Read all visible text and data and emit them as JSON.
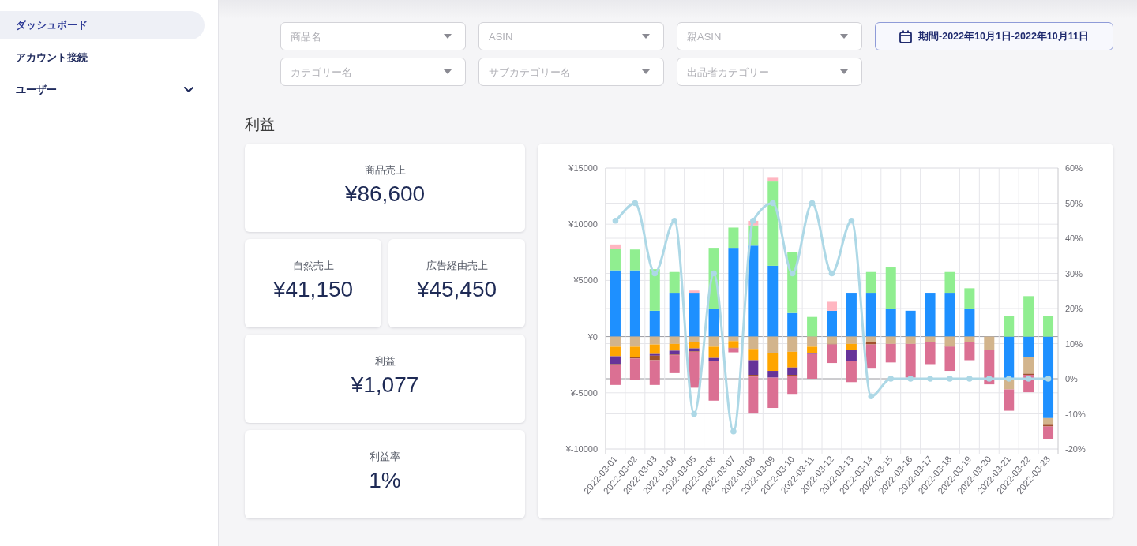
{
  "sidebar": {
    "items": [
      {
        "kind": "link",
        "label": "ダッシュボード",
        "selected": true
      },
      {
        "kind": "link",
        "label": "アカウント接続",
        "selected": false
      },
      {
        "kind": "group",
        "label": "ユーザー",
        "selected": false,
        "expanded": false
      }
    ]
  },
  "filters": [
    {
      "placeholder": "商品名"
    },
    {
      "placeholder": "ASIN"
    },
    {
      "placeholder": "親ASIN"
    },
    {
      "placeholder": "カテゴリー名"
    },
    {
      "placeholder": "サブカテゴリー名"
    },
    {
      "placeholder": "出品者カテゴリー"
    }
  ],
  "date_button": {
    "label": "期間-2022年10月1日-2022年10月11日"
  },
  "section": {
    "title": "利益"
  },
  "metric_rows": [
    [
      {
        "label": "商品売上",
        "value": "¥86,600"
      }
    ],
    [
      {
        "label": "自然売上",
        "value": "¥41,150"
      },
      {
        "label": "広告経由売上",
        "value": "¥45,450"
      }
    ],
    [
      {
        "label": "利益",
        "value": "¥1,077"
      }
    ],
    [
      {
        "label": "利益率",
        "value": "1%"
      }
    ]
  ],
  "chart": {
    "chart_data": {
      "type": "bar",
      "stacked": true,
      "grid": true,
      "categories": [
        "2022-03-01",
        "2022-03-02",
        "2022-03-03",
        "2022-03-04",
        "2022-03-05",
        "2022-03-06",
        "2022-03-07",
        "2022-03-08",
        "2022-03-09",
        "2022-03-10",
        "2022-03-11",
        "2022-03-12",
        "2022-03-13",
        "2022-03-14",
        "2022-03-15",
        "2022-03-16",
        "2022-03-17",
        "2022-03-18",
        "2022-03-19",
        "2022-03-20",
        "2022-03-21",
        "2022-03-22",
        "2022-03-23"
      ],
      "ylim": [
        -10000,
        15000
      ],
      "yticks": [
        {
          "value": 15000,
          "label": "¥15000"
        },
        {
          "value": 10000,
          "label": "¥10000"
        },
        {
          "value": 5000,
          "label": "¥5000"
        },
        {
          "value": 0,
          "label": "¥0"
        },
        {
          "value": -5000,
          "label": "¥-5000"
        },
        {
          "value": -10000,
          "label": "¥-10000"
        }
      ],
      "y2lim": [
        -20,
        60
      ],
      "y2ticks": [
        {
          "value": 60,
          "label": "60%"
        },
        {
          "value": 50,
          "label": "50%"
        },
        {
          "value": 40,
          "label": "40%"
        },
        {
          "value": 30,
          "label": "30%"
        },
        {
          "value": 20,
          "label": "20%"
        },
        {
          "value": 10,
          "label": "10%"
        },
        {
          "value": 0,
          "label": "0%"
        },
        {
          "value": -10,
          "label": "-10%"
        },
        {
          "value": -20,
          "label": "-20%"
        }
      ],
      "series": [
        {
          "type": "bar",
          "color": "#1e90ff",
          "values": [
            5900,
            5900,
            2300,
            3900,
            3900,
            2500,
            7900,
            8100,
            6300,
            2100,
            0,
            2300,
            3900,
            3900,
            2500,
            2300,
            3900,
            3900,
            2500,
            0,
            -3750,
            -1850,
            -7250
          ]
        },
        {
          "type": "bar",
          "color": "#90ee90",
          "values": [
            1900,
            1850,
            3700,
            1850,
            0,
            5400,
            1800,
            1800,
            7500,
            5450,
            1750,
            0,
            0,
            1850,
            3650,
            0,
            0,
            1850,
            1800,
            0,
            1800,
            3600,
            1800
          ]
        },
        {
          "type": "bar",
          "color": "#ffb6c1",
          "values": [
            400,
            0,
            0,
            0,
            200,
            0,
            0,
            400,
            400,
            0,
            0,
            800,
            0,
            0,
            0,
            0,
            0,
            0,
            0,
            0,
            0,
            0,
            0
          ]
        },
        {
          "type": "bar",
          "color": "#d2b48c",
          "values": [
            -900,
            -900,
            -700,
            -650,
            -450,
            -900,
            -400,
            -1100,
            -1500,
            -1350,
            -900,
            -650,
            -650,
            -450,
            -650,
            -650,
            -450,
            -800,
            -450,
            -1150,
            -950,
            -1450,
            -600
          ]
        },
        {
          "type": "bar",
          "color": "#ffa500",
          "values": [
            -850,
            -900,
            -850,
            -600,
            -600,
            -1000,
            -600,
            -1000,
            -1550,
            -1400,
            -550,
            0,
            -550,
            0,
            0,
            0,
            0,
            0,
            0,
            0,
            0,
            0,
            0
          ]
        },
        {
          "type": "bar",
          "color": "#663399",
          "values": [
            -700,
            0,
            -150,
            -350,
            -250,
            -250,
            0,
            -1300,
            -600,
            -650,
            -100,
            0,
            -950,
            0,
            0,
            0,
            0,
            0,
            0,
            0,
            0,
            0,
            0
          ]
        },
        {
          "type": "bar",
          "color": "#a0522d",
          "values": [
            -100,
            -150,
            -400,
            -50,
            -50,
            0,
            -50,
            -150,
            0,
            -100,
            0,
            -50,
            0,
            -250,
            0,
            0,
            -50,
            -100,
            -50,
            0,
            0,
            -100,
            -150
          ]
        },
        {
          "type": "bar",
          "color": "#db7093",
          "values": [
            -1750,
            -1900,
            -2200,
            -1600,
            -3200,
            -3550,
            -350,
            -3300,
            -2700,
            -1600,
            -2200,
            -1650,
            -1900,
            -2150,
            -1650,
            -3000,
            -1950,
            -2150,
            -1600,
            -3100,
            -1900,
            -1550,
            -1100
          ]
        },
        {
          "type": "line",
          "axis": "y2",
          "marker": "circle",
          "color": "#add8e6",
          "values": [
            45,
            50,
            30,
            45,
            -10,
            30,
            -15,
            45,
            50,
            30,
            50,
            30,
            45,
            -5,
            0,
            0,
            0,
            0,
            0,
            0,
            0,
            0,
            0
          ]
        }
      ]
    }
  }
}
